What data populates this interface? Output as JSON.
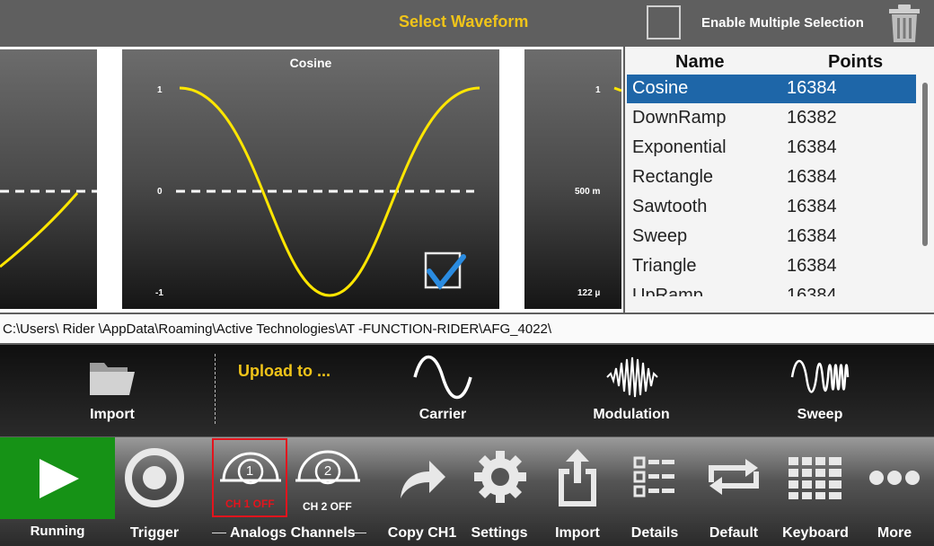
{
  "header": {
    "title": "Select Waveform",
    "multi_select_label": "Enable Multiple Selection"
  },
  "preview": {
    "center_title": "Cosine",
    "center_y_top": "1",
    "center_y_mid": "0",
    "center_y_bot": "-1",
    "right_y_top": "1",
    "right_y_mid": "500 m",
    "right_y_bot": "122 µ"
  },
  "list": {
    "col_name": "Name",
    "col_points": "Points",
    "rows": [
      {
        "name": "Cosine",
        "points": "16384",
        "selected": true
      },
      {
        "name": "DownRamp",
        "points": "16382"
      },
      {
        "name": "Exponential",
        "points": "16384"
      },
      {
        "name": "Rectangle",
        "points": "16384"
      },
      {
        "name": "Sawtooth",
        "points": "16384"
      },
      {
        "name": "Sweep",
        "points": "16384"
      },
      {
        "name": "Triangle",
        "points": "16384"
      },
      {
        "name": "UpRamp",
        "points": "16384"
      }
    ]
  },
  "path": "C:\\Users\\ Rider \\AppData\\Roaming\\Active Technologies\\AT -FUNCTION-RIDER\\AFG_4022\\",
  "upload": {
    "import_label": "Import",
    "upload_to": "Upload to ...",
    "carrier": "Carrier",
    "modulation": "Modulation",
    "sweep": "Sweep"
  },
  "bottom": {
    "running": "Running",
    "trigger": "Trigger",
    "analog_channels": "Analogs Channels",
    "ch1_num": "1",
    "ch1_status": "CH 1 OFF",
    "ch2_num": "2",
    "ch2_status": "CH 2 OFF",
    "copy_ch1": "Copy CH1",
    "settings": "Settings",
    "import": "Import",
    "details": "Details",
    "default": "Default",
    "keyboard": "Keyboard",
    "more": "More"
  },
  "colors": {
    "accent_yellow": "#f0c419",
    "selection_blue": "#1e66a8",
    "running_green": "#169216",
    "ch1_red": "#e3141d",
    "waveform_yellow": "#ffe600"
  }
}
